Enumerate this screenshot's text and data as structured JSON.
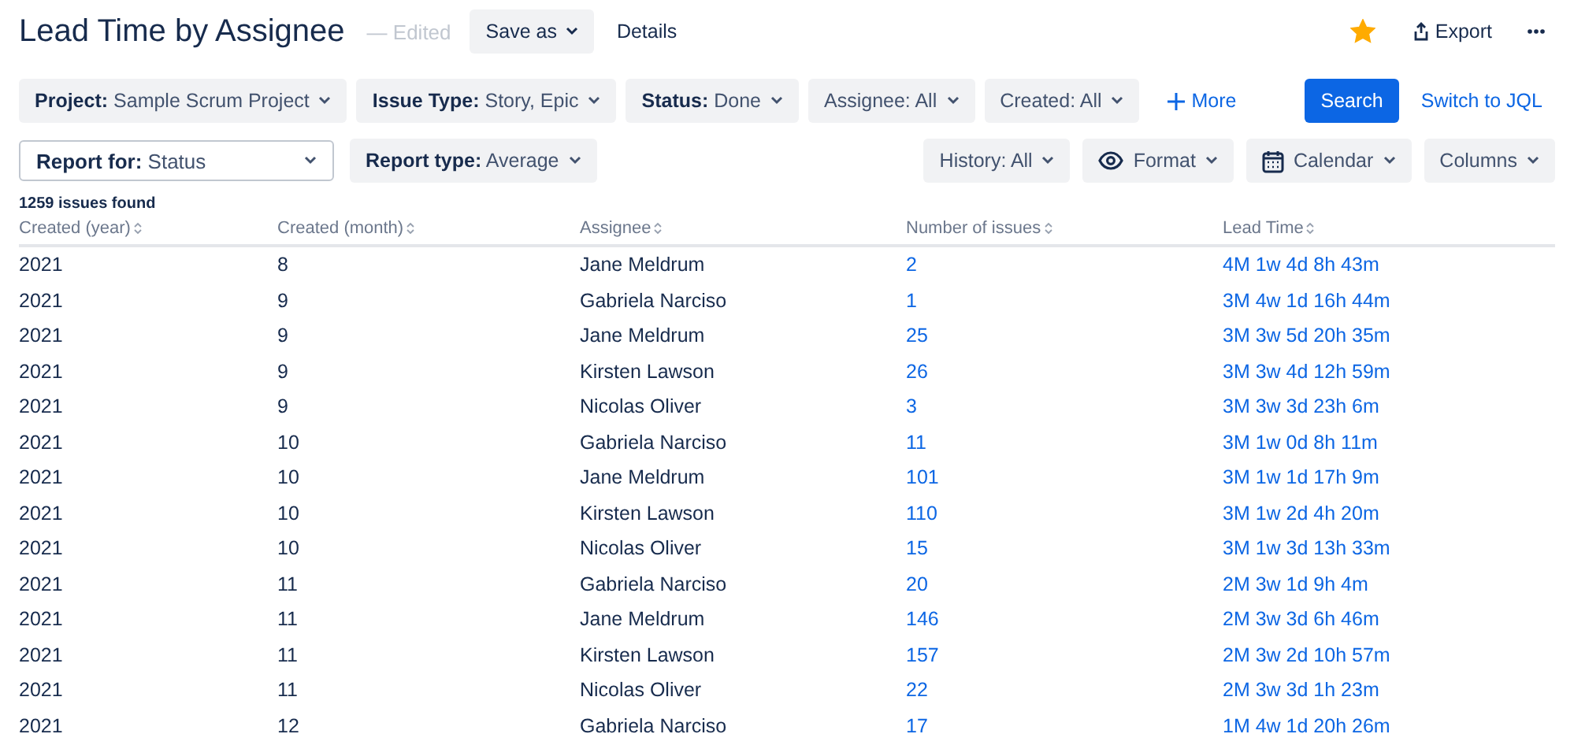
{
  "header": {
    "title": "Lead Time by Assignee",
    "status": "— Edited",
    "save_button": "Save as",
    "details_link": "Details",
    "starred": true,
    "export_button": "Export"
  },
  "filters": [
    {
      "label": "Project:",
      "value": "Sample Scrum Project"
    },
    {
      "label": "Issue Type:",
      "value": "Story, Epic"
    },
    {
      "label": "Status:",
      "value": "Done"
    },
    {
      "label": "Assignee:",
      "value": "All",
      "bold": false
    },
    {
      "label": "Created:",
      "value": "All",
      "bold": false
    }
  ],
  "more_button": "More",
  "search_button": "Search",
  "jql_link": "Switch to JQL",
  "report_for": {
    "label": "Report for:",
    "value": "Status"
  },
  "report_type": {
    "label": "Report type:",
    "value": "Average"
  },
  "view_buttons": [
    {
      "kind": "plain",
      "label": "History: All"
    },
    {
      "kind": "eye",
      "label": "Format"
    },
    {
      "kind": "calendar",
      "label": "Calendar"
    },
    {
      "kind": "plain",
      "label": "Columns"
    }
  ],
  "result_count": "1259 issues found",
  "table": {
    "columns": [
      "Created (year)",
      "Created (month)",
      "Assignee",
      "Number of issues",
      "Lead Time"
    ],
    "rows": [
      [
        "2021",
        "8",
        "Jane Meldrum",
        "2",
        "4M 1w 4d 8h 43m"
      ],
      [
        "2021",
        "9",
        "Gabriela Narciso",
        "1",
        "3M 4w 1d 16h 44m"
      ],
      [
        "2021",
        "9",
        "Jane Meldrum",
        "25",
        "3M 3w 5d 20h 35m"
      ],
      [
        "2021",
        "9",
        "Kirsten Lawson",
        "26",
        "3M 3w 4d 12h 59m"
      ],
      [
        "2021",
        "9",
        "Nicolas Oliver",
        "3",
        "3M 3w 3d 23h 6m"
      ],
      [
        "2021",
        "10",
        "Gabriela Narciso",
        "11",
        "3M 1w 0d 8h 11m"
      ],
      [
        "2021",
        "10",
        "Jane Meldrum",
        "101",
        "3M 1w 1d 17h 9m"
      ],
      [
        "2021",
        "10",
        "Kirsten Lawson",
        "110",
        "3M 1w 2d 4h 20m"
      ],
      [
        "2021",
        "10",
        "Nicolas Oliver",
        "15",
        "3M 1w 3d 13h 33m"
      ],
      [
        "2021",
        "11",
        "Gabriela Narciso",
        "20",
        "2M 3w 1d 9h 4m"
      ],
      [
        "2021",
        "11",
        "Jane Meldrum",
        "146",
        "2M 3w 3d 6h 46m"
      ],
      [
        "2021",
        "11",
        "Kirsten Lawson",
        "157",
        "2M 3w 2d 10h 57m"
      ],
      [
        "2021",
        "11",
        "Nicolas Oliver",
        "22",
        "2M 3w 3d 1h 23m"
      ],
      [
        "2021",
        "12",
        "Gabriela Narciso",
        "17",
        "1M 4w 1d 20h 26m"
      ]
    ]
  }
}
